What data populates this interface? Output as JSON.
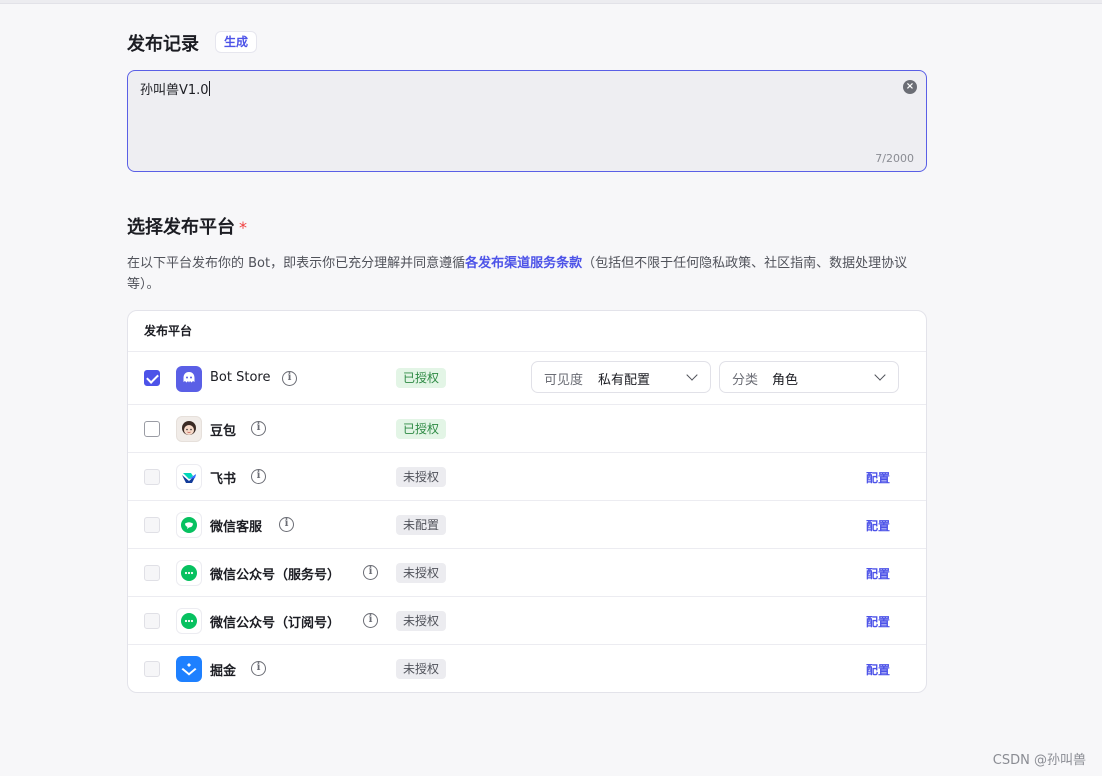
{
  "release": {
    "title": "发布记录",
    "generate_label": "生成",
    "value": "孙叫兽V1.0",
    "char_count": "7/2000"
  },
  "platforms_section": {
    "title": "选择发布平台",
    "required_mark": "*",
    "desc_before": "在以下平台发布你的 Bot，即表示你已充分理解并同意遵循",
    "desc_link": "各发布渠道服务条款",
    "desc_after": "（包括但不限于任何隐私政策、社区指南、数据处理协议等）。",
    "table_header": "发布平台"
  },
  "platforms": [
    {
      "name": "Bot Store",
      "status": "已授权",
      "checked": true
    },
    {
      "name": "豆包",
      "status": "已授权",
      "checked": false
    },
    {
      "name": "飞书",
      "status": "未授权",
      "config": "配置"
    },
    {
      "name": "微信客服",
      "status": "未配置",
      "config": "配置"
    },
    {
      "name": "微信公众号（服务号）",
      "status": "未授权",
      "config": "配置"
    },
    {
      "name": "微信公众号（订阅号）",
      "status": "未授权",
      "config": "配置"
    },
    {
      "name": "掘金",
      "status": "未授权",
      "config": "配置"
    }
  ],
  "botstore_options": {
    "visibility_label": "可见度",
    "visibility_value": "私有配置",
    "category_label": "分类",
    "category_value": "角色"
  },
  "info_glyph": "i",
  "clear_glyph": "×",
  "watermark": "CSDN @孙叫兽",
  "colors": {
    "accent": "#4d53e8",
    "authorized_bg": "#e3f5e6",
    "authorized_text": "#2e8a44",
    "required": "#f03d3d"
  }
}
